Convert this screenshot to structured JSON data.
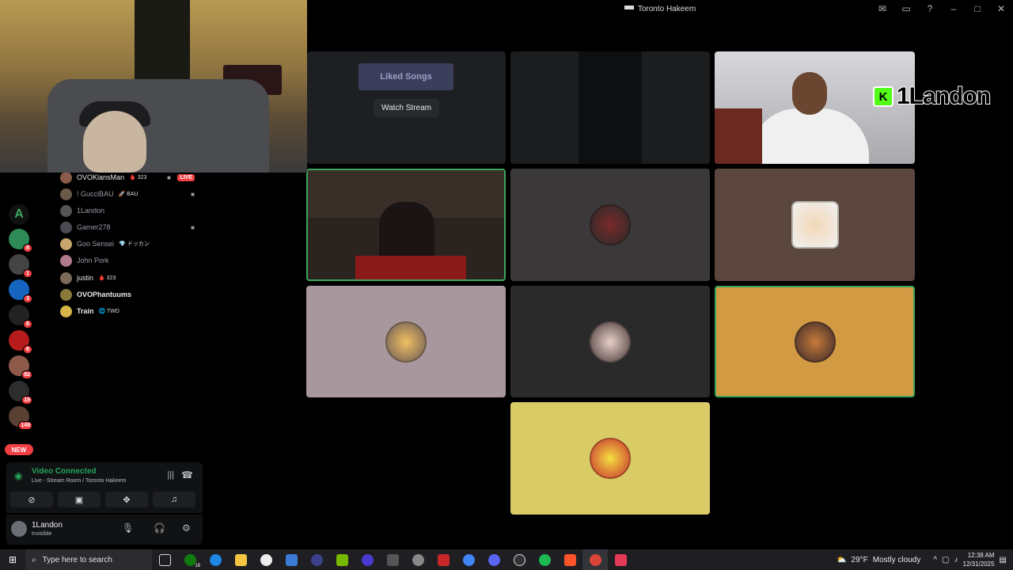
{
  "window": {
    "title": "Toronto Hakeem"
  },
  "members": [
    {
      "name": "OVOKlansMan",
      "tag": "🩸 323",
      "live": "LIVE",
      "camera": true,
      "active": true
    },
    {
      "name": "! GucciBAU",
      "tag": "🚀 BAU",
      "camera": true,
      "active": false
    },
    {
      "name": "1Landon",
      "tag": "",
      "camera": false,
      "active": false
    },
    {
      "name": "Gamer278",
      "tag": "",
      "camera": true,
      "active": false
    },
    {
      "name": "Goo Sensei",
      "tag": "💎 ドッカン",
      "camera": false,
      "active": false
    },
    {
      "name": "John Pork",
      "tag": "",
      "camera": false,
      "active": false
    },
    {
      "name": "justin",
      "tag": "🩸 323",
      "camera": false,
      "active": true
    },
    {
      "name": "OVOPhantuums",
      "tag": "",
      "camera": false,
      "active": true
    },
    {
      "name": "Train",
      "tag": "🌐 TWD",
      "camera": false,
      "active": true
    }
  ],
  "servers": [
    {
      "label": "A",
      "badge": "",
      "color": "#1a1a1a"
    },
    {
      "label": "",
      "badge": "8",
      "color": "#2e8b57"
    },
    {
      "label": "",
      "badge": "1",
      "color": "#444"
    },
    {
      "label": "",
      "badge": "3",
      "color": "#1565c0"
    },
    {
      "label": "",
      "badge": "8",
      "color": "#222"
    },
    {
      "label": "",
      "badge": "6",
      "color": "#b71c1c"
    },
    {
      "label": "",
      "badge": "92",
      "color": "#8d5a4a"
    },
    {
      "label": "",
      "badge": "19",
      "color": "#2d2d2d"
    },
    {
      "label": "",
      "badge": "149",
      "color": "#5a4033"
    }
  ],
  "new_label": "NEW",
  "voice": {
    "status": "Video Connected",
    "subtitle": "Live - Stream Room / Toronto Hakeem"
  },
  "user": {
    "name": "1Landon",
    "status": "Invisible"
  },
  "stream_tile": {
    "watch_label": "Watch Stream",
    "preview_text": "Liked Songs"
  },
  "name_overlay": {
    "badge": "K",
    "name": "1Landon"
  },
  "taskbar": {
    "search_placeholder": "Type here to search",
    "weather_temp": "29°F",
    "weather_desc": "Mostly cloudy",
    "time": "12:38 AM",
    "date": "12/31/2025",
    "xbox_badge": "18"
  },
  "colors": {
    "accent_green": "#23a55a",
    "speaking_border": "#3ba55c",
    "live_red": "#f23f43"
  }
}
